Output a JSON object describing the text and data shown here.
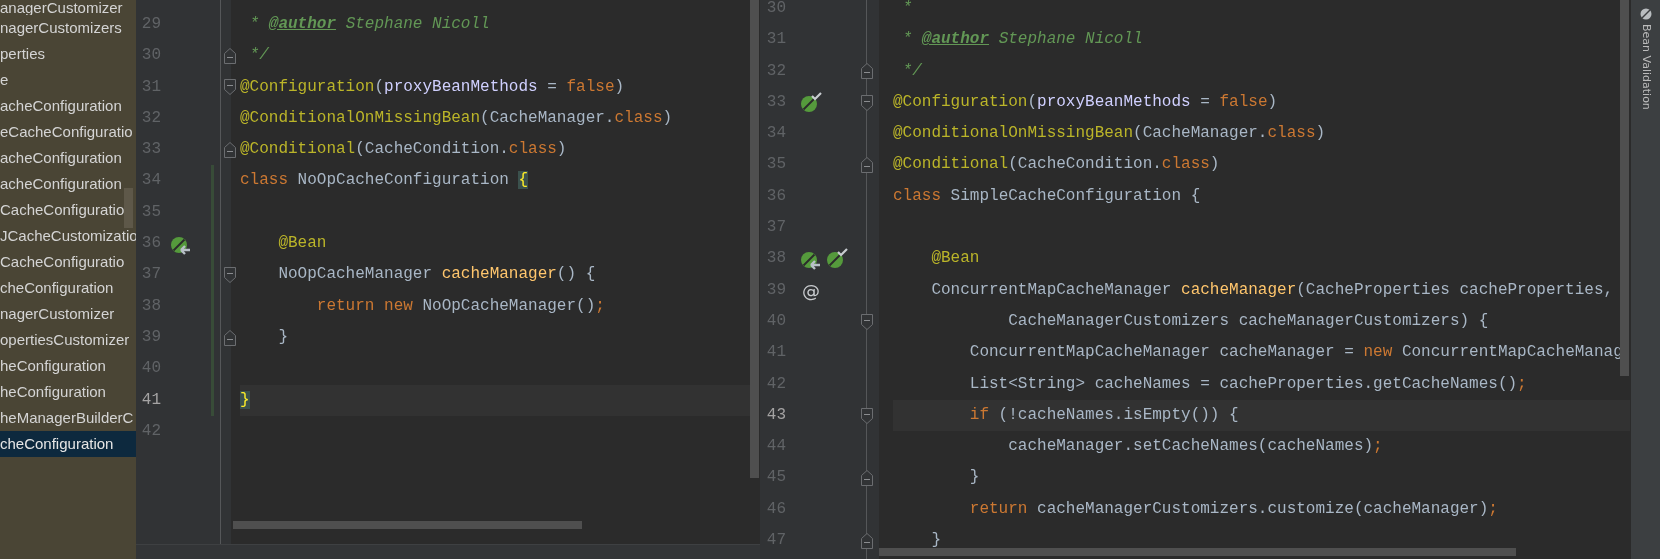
{
  "project_tree": {
    "items": [
      {
        "label": "anagerCustomizer",
        "selected": false
      },
      {
        "label": "nagerCustomizers",
        "selected": false
      },
      {
        "label": "perties",
        "selected": false
      },
      {
        "label": "e",
        "selected": false
      },
      {
        "label": "acheConfiguration",
        "selected": false
      },
      {
        "label": "eCacheConfiguratio",
        "selected": false
      },
      {
        "label": "acheConfiguration",
        "selected": false
      },
      {
        "label": "acheConfiguration",
        "selected": false
      },
      {
        "label": "CacheConfiguratio",
        "selected": false
      },
      {
        "label": "JCacheCustomizatio",
        "selected": false
      },
      {
        "label": "CacheConfiguratio",
        "selected": false
      },
      {
        "label": "cheConfiguration",
        "selected": false
      },
      {
        "label": "nagerCustomizer",
        "selected": false
      },
      {
        "label": "opertiesCustomizer",
        "selected": false
      },
      {
        "label": "heConfiguration",
        "selected": false
      },
      {
        "label": "heConfiguration",
        "selected": false
      },
      {
        "label": "heManagerBuilderC",
        "selected": false
      },
      {
        "label": "cheConfiguration",
        "selected": true
      }
    ]
  },
  "editors": [
    {
      "lines": [
        {
          "number": "29",
          "current": false,
          "modified": false,
          "tokens": [
            {
              "kind": "comment",
              "text": " * "
            },
            {
              "kind": "doctag",
              "text": "@author"
            },
            {
              "kind": "comment",
              "text": " Stephane Nicoll"
            }
          ]
        },
        {
          "number": "30",
          "current": false,
          "modified": false,
          "fold": {
            "kind": "end"
          },
          "tokens": [
            {
              "kind": "comment",
              "text": " */"
            }
          ]
        },
        {
          "number": "31",
          "current": false,
          "modified": false,
          "fold": {
            "kind": "start"
          },
          "tokens": [
            {
              "kind": "annotation",
              "text": "@Configuration"
            },
            {
              "kind": "plain",
              "text": "("
            },
            {
              "kind": "param",
              "text": "proxyBeanMethods"
            },
            {
              "kind": "plain",
              "text": " = "
            },
            {
              "kind": "keyword",
              "text": "false"
            },
            {
              "kind": "plain",
              "text": ")"
            }
          ]
        },
        {
          "number": "32",
          "current": false,
          "modified": false,
          "tokens": [
            {
              "kind": "annotation",
              "text": "@ConditionalOnMissingBean"
            },
            {
              "kind": "plain",
              "text": "(CacheManager."
            },
            {
              "kind": "keyword",
              "text": "class"
            },
            {
              "kind": "plain",
              "text": ")"
            }
          ]
        },
        {
          "number": "33",
          "current": false,
          "modified": false,
          "fold": {
            "kind": "end"
          },
          "tokens": [
            {
              "kind": "annotation",
              "text": "@Conditional"
            },
            {
              "kind": "plain",
              "text": "(CacheCondition."
            },
            {
              "kind": "keyword",
              "text": "class"
            },
            {
              "kind": "plain",
              "text": ")"
            }
          ]
        },
        {
          "number": "34",
          "current": false,
          "modified": true,
          "tokens": [
            {
              "kind": "keyword",
              "text": "class"
            },
            {
              "kind": "plain",
              "text": " NoOpCacheConfiguration "
            },
            {
              "kind": "brace",
              "text": "{"
            }
          ]
        },
        {
          "number": "35",
          "current": false,
          "modified": true
        },
        {
          "number": "36",
          "current": false,
          "modified": true,
          "icons": [
            {
              "kind": "bean-run"
            }
          ],
          "tokens": [
            {
              "kind": "annotation",
              "text": "    @Bean"
            }
          ]
        },
        {
          "number": "37",
          "current": false,
          "modified": true,
          "fold": {
            "kind": "start"
          },
          "tokens": [
            {
              "kind": "plain",
              "text": "    NoOpCacheManager "
            },
            {
              "kind": "method",
              "text": "cacheManager"
            },
            {
              "kind": "plain",
              "text": "() {"
            }
          ]
        },
        {
          "number": "38",
          "current": false,
          "modified": true,
          "tokens": [
            {
              "kind": "keyword",
              "text": "        return new "
            },
            {
              "kind": "plain",
              "text": "NoOpCacheManager()"
            },
            {
              "kind": "keyword",
              "text": ";"
            }
          ]
        },
        {
          "number": "39",
          "current": false,
          "modified": true,
          "fold": {
            "kind": "end"
          },
          "tokens": [
            {
              "kind": "plain",
              "text": "    }"
            }
          ]
        },
        {
          "number": "40",
          "current": false,
          "modified": true
        },
        {
          "number": "41",
          "current": true,
          "modified": true,
          "tokens": [
            {
              "kind": "brace",
              "text": "}"
            }
          ]
        },
        {
          "number": "42",
          "current": false,
          "modified": false
        }
      ]
    },
    {
      "lines": [
        {
          "number": "30",
          "current": false,
          "tokens": [
            {
              "kind": "comment",
              "text": " *"
            }
          ]
        },
        {
          "number": "31",
          "current": false,
          "tokens": [
            {
              "kind": "comment",
              "text": " * "
            },
            {
              "kind": "doctag",
              "text": "@author"
            },
            {
              "kind": "comment",
              "text": " Stephane Nicoll"
            }
          ]
        },
        {
          "number": "32",
          "current": false,
          "fold": {
            "kind": "end"
          },
          "tokens": [
            {
              "kind": "comment",
              "text": " */"
            }
          ]
        },
        {
          "number": "33",
          "current": false,
          "fold": {
            "kind": "start"
          },
          "icons": [
            {
              "kind": "bean-check"
            }
          ],
          "tokens": [
            {
              "kind": "annotation",
              "text": "@Configuration"
            },
            {
              "kind": "plain",
              "text": "("
            },
            {
              "kind": "param",
              "text": "proxyBeanMethods"
            },
            {
              "kind": "plain",
              "text": " = "
            },
            {
              "kind": "keyword",
              "text": "false"
            },
            {
              "kind": "plain",
              "text": ")"
            }
          ]
        },
        {
          "number": "34",
          "current": false,
          "tokens": [
            {
              "kind": "annotation",
              "text": "@ConditionalOnMissingBean"
            },
            {
              "kind": "plain",
              "text": "(CacheManager."
            },
            {
              "kind": "keyword",
              "text": "class"
            },
            {
              "kind": "plain",
              "text": ")"
            }
          ]
        },
        {
          "number": "35",
          "current": false,
          "fold": {
            "kind": "end"
          },
          "tokens": [
            {
              "kind": "annotation",
              "text": "@Conditional"
            },
            {
              "kind": "plain",
              "text": "(CacheCondition."
            },
            {
              "kind": "keyword",
              "text": "class"
            },
            {
              "kind": "plain",
              "text": ")"
            }
          ]
        },
        {
          "number": "36",
          "current": false,
          "tokens": [
            {
              "kind": "keyword",
              "text": "class"
            },
            {
              "kind": "plain",
              "text": " SimpleCacheConfiguration {"
            }
          ]
        },
        {
          "number": "37",
          "current": false
        },
        {
          "number": "38",
          "current": false,
          "icons": [
            {
              "kind": "bean-run"
            },
            {
              "kind": "bean-check"
            }
          ],
          "tokens": [
            {
              "kind": "annotation",
              "text": "    @Bean"
            }
          ]
        },
        {
          "number": "39",
          "current": false,
          "icons": [
            {
              "kind": "symbol",
              "text": "@"
            }
          ],
          "tokens": [
            {
              "kind": "plain",
              "text": "    ConcurrentMapCacheManager "
            },
            {
              "kind": "method",
              "text": "cacheManager"
            },
            {
              "kind": "plain",
              "text": "(CacheProperties cacheProperties,"
            }
          ]
        },
        {
          "number": "40",
          "current": false,
          "fold": {
            "kind": "start"
          },
          "tokens": [
            {
              "kind": "plain",
              "text": "            CacheManagerCustomizers cacheManagerCustomizers) {"
            }
          ]
        },
        {
          "number": "41",
          "current": false,
          "tokens": [
            {
              "kind": "plain",
              "text": "        ConcurrentMapCacheManager cacheManager = "
            },
            {
              "kind": "keyword",
              "text": "new"
            },
            {
              "kind": "plain",
              "text": " ConcurrentMapCacheManag"
            }
          ]
        },
        {
          "number": "42",
          "current": false,
          "tokens": [
            {
              "kind": "plain",
              "text": "        List<String> cacheNames = cacheProperties.getCacheNames()"
            },
            {
              "kind": "keyword",
              "text": ";"
            }
          ]
        },
        {
          "number": "43",
          "current": true,
          "fold": {
            "kind": "start"
          },
          "tokens": [
            {
              "kind": "keyword",
              "text": "        if"
            },
            {
              "kind": "plain",
              "text": " (!cacheNames.isEmpty()) {"
            }
          ]
        },
        {
          "number": "44",
          "current": false,
          "tokens": [
            {
              "kind": "plain",
              "text": "            cacheManager.setCacheNames(cacheNames)"
            },
            {
              "kind": "keyword",
              "text": ";"
            }
          ]
        },
        {
          "number": "45",
          "current": false,
          "fold": {
            "kind": "end"
          },
          "tokens": [
            {
              "kind": "plain",
              "text": "        }"
            }
          ]
        },
        {
          "number": "46",
          "current": false,
          "tokens": [
            {
              "kind": "keyword",
              "text": "        return"
            },
            {
              "kind": "plain",
              "text": " cacheManagerCustomizers.customize(cacheManager)"
            },
            {
              "kind": "keyword",
              "text": ";"
            }
          ]
        },
        {
          "number": "47",
          "current": false,
          "fold": {
            "kind": "end"
          },
          "tokens": [
            {
              "kind": "plain",
              "text": "    }"
            }
          ]
        }
      ]
    }
  ],
  "tool_window_strip": {
    "label": "Bean Validation"
  }
}
